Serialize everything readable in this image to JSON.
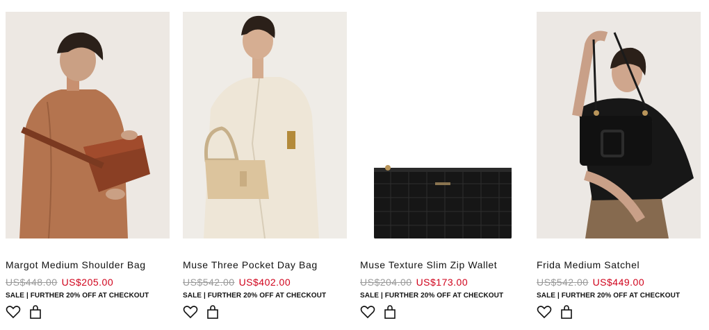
{
  "products": [
    {
      "name": "Margot Medium Shoulder Bag",
      "original_price": "US$448.00",
      "sale_price": "US$205.00",
      "promo": "SALE | FURTHER 20% OFF AT CHECKOUT",
      "image": "model-with-brown-shoulder-bag"
    },
    {
      "name": "Muse Three Pocket Day Bag",
      "original_price": "US$542.00",
      "sale_price": "US$402.00",
      "promo": "SALE | FURTHER 20% OFF AT CHECKOUT",
      "image": "model-with-beige-day-bag"
    },
    {
      "name": "Muse Texture Slim Zip Wallet",
      "original_price": "US$204.00",
      "sale_price": "US$173.00",
      "promo": "SALE | FURTHER 20% OFF AT CHECKOUT",
      "image": "black-croc-texture-wallet"
    },
    {
      "name": "Frida Medium Satchel",
      "original_price": "US$542.00",
      "sale_price": "US$449.00",
      "promo": "SALE | FURTHER 20% OFF AT CHECKOUT",
      "image": "model-with-black-satchel"
    }
  ],
  "colors": {
    "sale_price": "#d0021b",
    "original_price": "#9a9a9a",
    "image_backdrop": "#ece7e2"
  },
  "icons": {
    "wishlist": "heart-icon",
    "add_to_bag": "shopping-bag-icon"
  }
}
